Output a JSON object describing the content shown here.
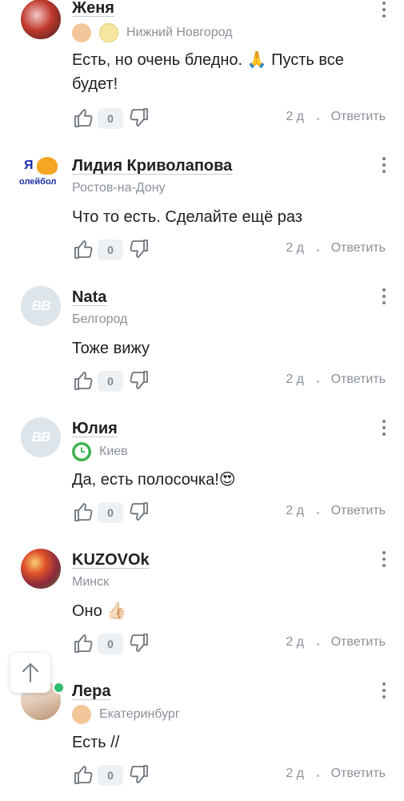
{
  "comments": [
    {
      "name": "Женя",
      "location": "Нижний Новгород",
      "text": "Есть, но очень бледно. 🙏 Пусть все будет!",
      "likes": "0",
      "age": "2 д",
      "reply": "Ответить"
    },
    {
      "name": "Лидия Криволапова",
      "location": "Ростов-на-Дону",
      "text": "Что то есть. Сделайте ещё раз",
      "likes": "0",
      "age": "2 д",
      "reply": "Ответить",
      "avatar_text_top": "Я",
      "avatar_text_bottom": "олейбол"
    },
    {
      "name": "Nata",
      "location": "Белгород",
      "text": "Тоже вижу",
      "likes": "0",
      "age": "2 д",
      "reply": "Ответить",
      "avatar_text": "BB"
    },
    {
      "name": "Юлия",
      "location": "Киев",
      "text": "Да, есть полосочка!😍",
      "likes": "0",
      "age": "2 д",
      "reply": "Ответить",
      "avatar_text": "BB"
    },
    {
      "name": "KUZOVOk",
      "location": "Минск",
      "text": "Оно 👍🏻",
      "likes": "0",
      "age": "2 д",
      "reply": "Ответить"
    },
    {
      "name": "Лера",
      "location": "Екатеринбург",
      "text": "Есть //",
      "likes": "0",
      "age": "2 д",
      "reply": "Ответить"
    }
  ],
  "colors": {
    "accent_online": "#2ebd6b",
    "muted": "#8a9199",
    "text": "#202124"
  },
  "icons": [
    "thumb-up-icon",
    "thumb-down-icon",
    "kebab-menu-icon",
    "arrow-up-icon",
    "badge-icon",
    "clock-icon"
  ]
}
